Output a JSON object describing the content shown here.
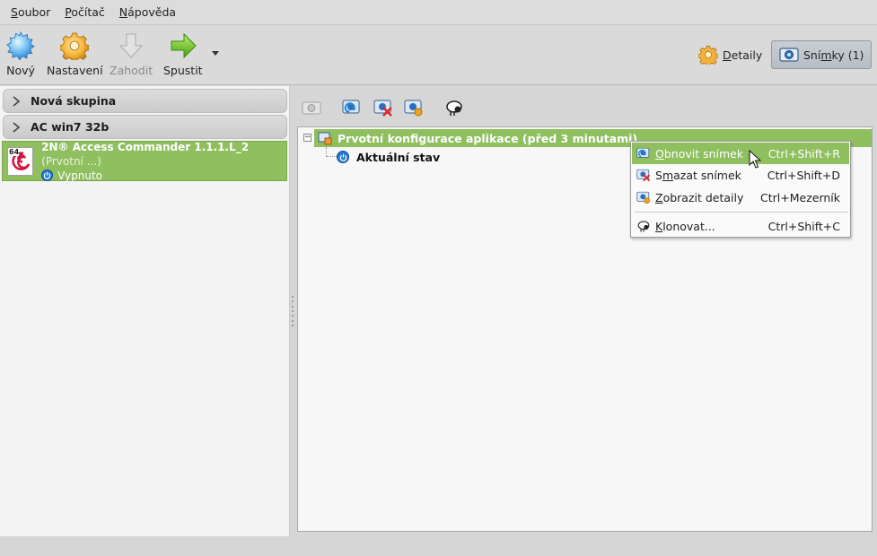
{
  "menubar": {
    "items": [
      {
        "u": "S",
        "rest": "oubor"
      },
      {
        "u": "P",
        "rest": "očítač"
      },
      {
        "u": "N",
        "rest": "ápověda"
      }
    ]
  },
  "toolbar": {
    "new_label": "Nový",
    "settings_label": "Nastavení",
    "discard_label": "Zahodit",
    "start_label": "Spustit",
    "details_label_u": "D",
    "details_label_rest": "etaily",
    "snapshots_label_pre": "Sní",
    "snapshots_label_u": "m",
    "snapshots_label_rest": "ky (1)"
  },
  "vm_list": {
    "groups": [
      {
        "label": "Nová skupina"
      },
      {
        "label": "AC win7 32b"
      }
    ],
    "selected_vm": {
      "name": "2N® Access Commander 1.1.1.L_2",
      "snapshot_hint": "(Prvotní ...)",
      "state": "Vypnuto",
      "os_badge": "64"
    }
  },
  "snapshot_tree": {
    "snapshot_label": "Prvotní konfigurace aplikace (před 3 minutami)",
    "current_state_label": "Aktuální stav",
    "expander": "−"
  },
  "context_menu": {
    "items": [
      {
        "pre": "",
        "u": "O",
        "rest": "bnovit snímek",
        "shortcut": "Ctrl+Shift+R"
      },
      {
        "pre": "S",
        "u": "m",
        "rest": "azat snímek",
        "shortcut": "Ctrl+Shift+D"
      },
      {
        "pre": "",
        "u": "Z",
        "rest": "obrazit detaily",
        "shortcut": "Ctrl+Mezerník"
      },
      {
        "pre": "",
        "u": "K",
        "rest": "lonovat...",
        "shortcut": "Ctrl+Shift+C"
      }
    ]
  },
  "colors": {
    "selection_green": "#8fbf5f",
    "power_blue": "#2a7bd4"
  }
}
